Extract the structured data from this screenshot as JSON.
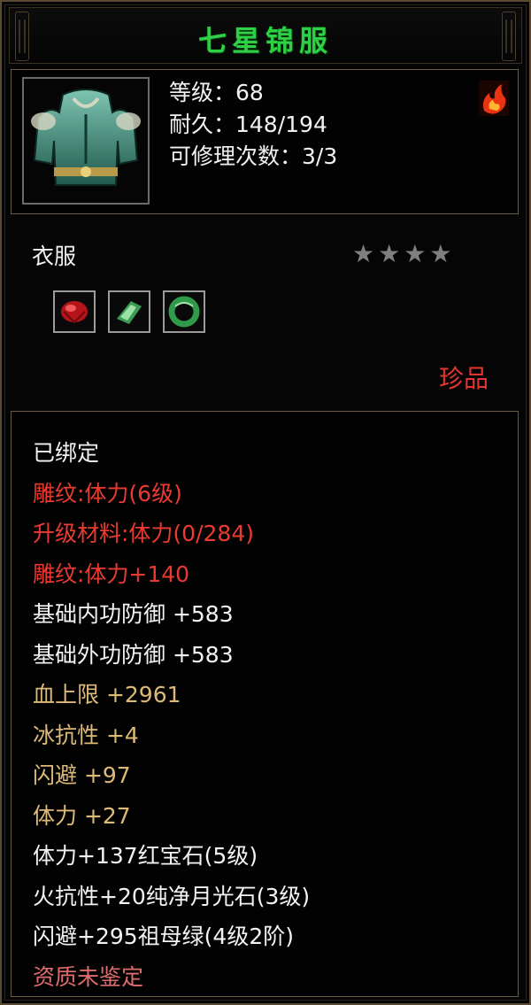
{
  "title": "七星锦服",
  "item": {
    "level": "等级：68",
    "durability": "耐久：148/194",
    "repairs": "可修理次数：3/3",
    "icon": "armor-robe-icon",
    "badge_icon": "flame-icon"
  },
  "type_label": "衣服",
  "stars": "★★★★",
  "gems": [
    "ruby-gem-icon",
    "green-crystal-gem-icon",
    "jade-ring-gem-icon"
  ],
  "rarity": "珍品",
  "properties": [
    "已绑定",
    "雕纹:体力(6级)",
    "升级材料:体力(0/284)",
    "雕纹:体力+140",
    "基础内功防御  +583",
    "基础外功防御  +583",
    "血上限  +2961",
    "冰抗性  +4",
    "闪避  +97",
    "体力  +27",
    "体力+137红宝石(5级)",
    "火抗性+20纯净月光石(3级)",
    "闪避+295祖母绿(4级2阶)",
    "资质未鉴定"
  ],
  "colors": {
    "title": "#2ed145",
    "red": "#ea3a31",
    "gold": "#ddba77",
    "white": "#f3f3f3",
    "pink": "#e06d6d"
  }
}
